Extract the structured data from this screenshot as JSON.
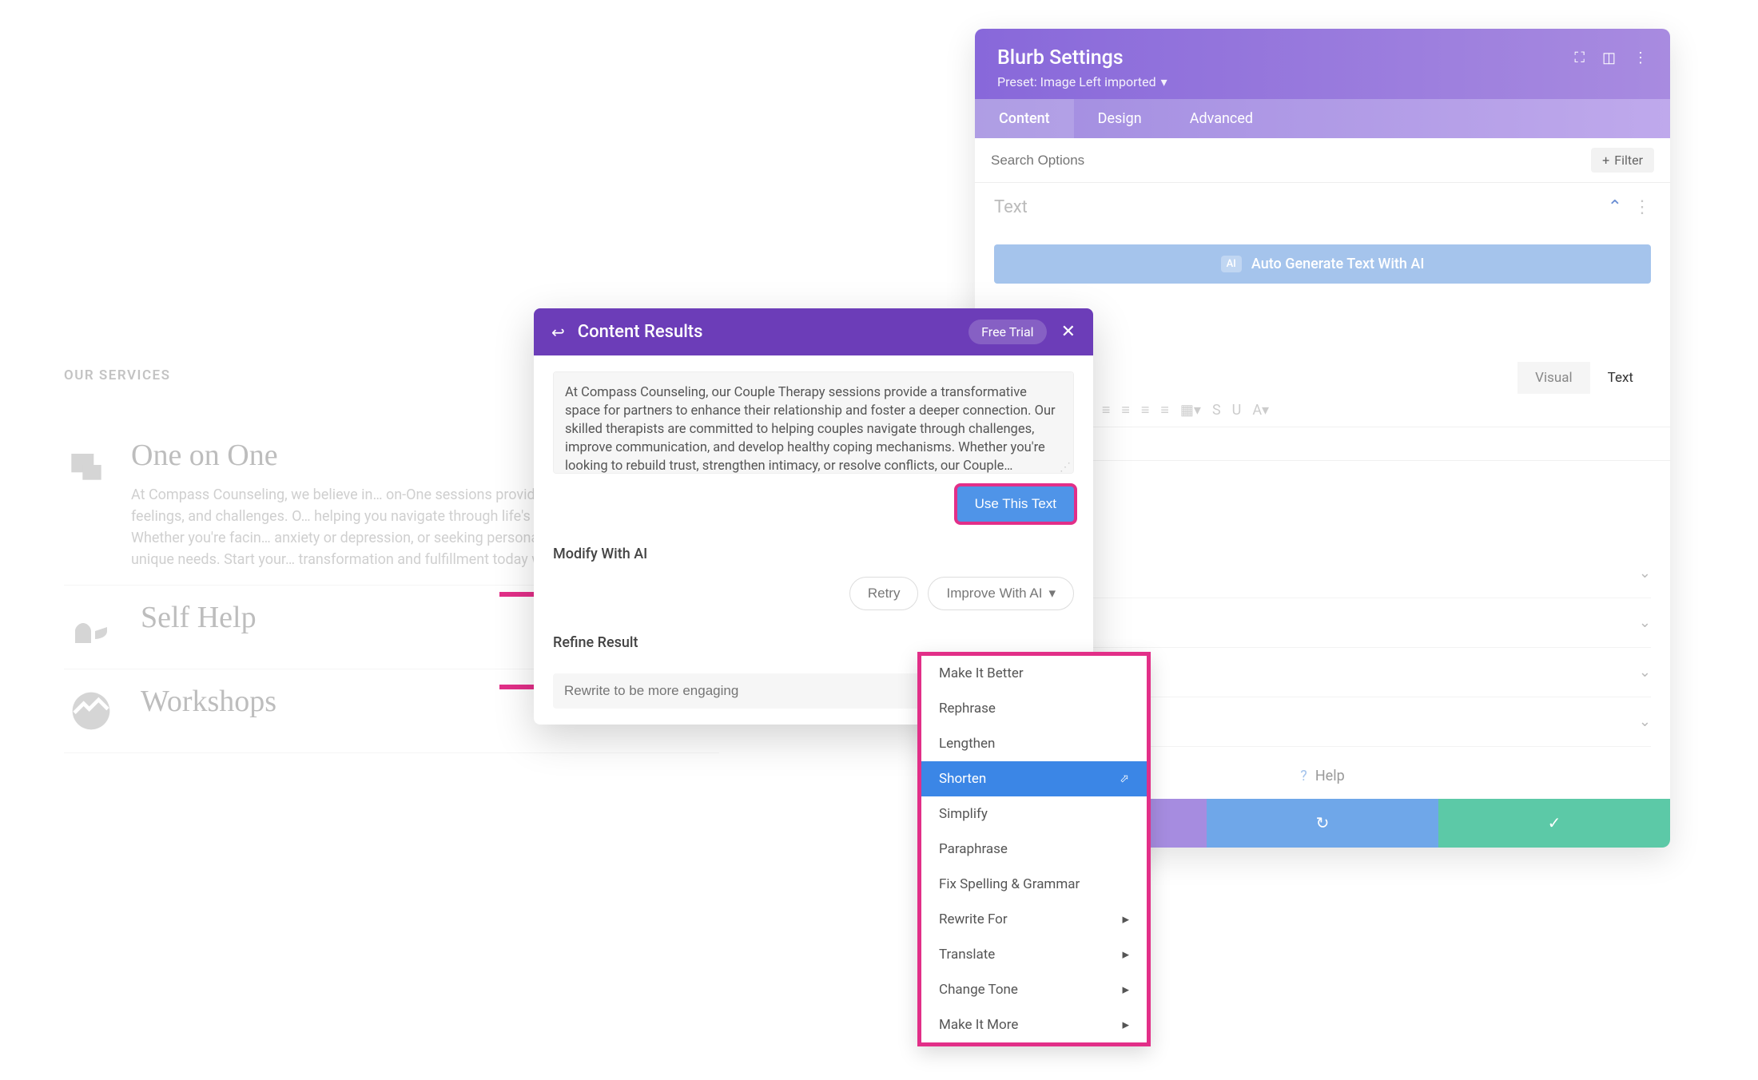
{
  "services": {
    "label": "OUR SERVICES",
    "items": [
      {
        "title": "One on One",
        "body": "At Compass Counseling, we believe in… on-One sessions provide a safe and s… thoughts, feelings, and challenges. O… helping you navigate through life's ups a… your true potential. Whether you're facin… anxiety or depression, or seeking persona… tailored to meet your unique needs. Start your… transformation and fulfillment today with Compa…"
      },
      {
        "title": "Self Help",
        "body": ""
      },
      {
        "title": "Workshops",
        "body": ""
      }
    ]
  },
  "settings": {
    "title": "Blurb Settings",
    "preset": "Preset: Image Left imported",
    "tabs": [
      "Content",
      "Design",
      "Advanced"
    ],
    "active_tab": "Content",
    "search_placeholder": "Search Options",
    "filter": "Filter",
    "text_section": "Text",
    "ai_button": "Auto Generate Text With AI",
    "ai_badge": "AI",
    "editor_tabs": [
      "Visual",
      "Text"
    ],
    "help": "Help",
    "accordion": [
      "",
      "",
      "",
      ""
    ]
  },
  "content_results": {
    "title": "Content Results",
    "badge": "Free Trial",
    "text": "At Compass Counseling, our Couple Therapy sessions provide a transformative space for partners to enhance their relationship and foster a deeper connection. Our skilled therapists are committed to helping couples navigate through challenges, improve communication, and develop healthy coping mechanisms. Whether you're looking to rebuild trust, strengthen intimacy, or resolve conflicts, our Couple…",
    "use_btn": "Use This Text",
    "modify_label": "Modify With AI",
    "refine_label": "Refine Result",
    "retry": "Retry",
    "improve": "Improve With AI",
    "refine_placeholder": "Rewrite to be more engaging"
  },
  "dropdown": {
    "items": [
      {
        "label": "Make It Better",
        "submenu": false
      },
      {
        "label": "Rephrase",
        "submenu": false
      },
      {
        "label": "Lengthen",
        "submenu": false
      },
      {
        "label": "Shorten",
        "submenu": false,
        "highlighted": true
      },
      {
        "label": "Simplify",
        "submenu": false
      },
      {
        "label": "Paraphrase",
        "submenu": false
      },
      {
        "label": "Fix Spelling & Grammar",
        "submenu": false
      },
      {
        "label": "Rewrite For",
        "submenu": true
      },
      {
        "label": "Translate",
        "submenu": true
      },
      {
        "label": "Change Tone",
        "submenu": true
      },
      {
        "label": "Make It More",
        "submenu": true
      }
    ]
  }
}
